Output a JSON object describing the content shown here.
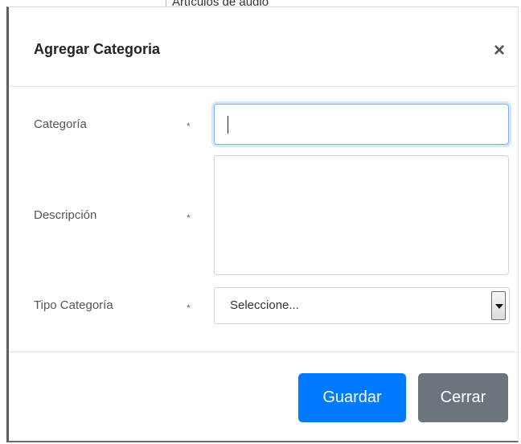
{
  "background": {
    "partial_text": "Artículos de audio"
  },
  "modal": {
    "title": "Agregar Categoria",
    "close_symbol": "×"
  },
  "form": {
    "categoria": {
      "label": "Categoría",
      "required_mark": "*",
      "value": ""
    },
    "descripcion": {
      "label": "Descripción",
      "required_mark": "*",
      "value": ""
    },
    "tipo_categoria": {
      "label": "Tipo Categoría",
      "required_mark": "*",
      "selected": "Seleccione..."
    }
  },
  "footer": {
    "save_label": "Guardar",
    "close_label": "Cerrar"
  },
  "colors": {
    "primary": "#007bff",
    "secondary": "#6c757d",
    "focus_ring": "#80bdff"
  }
}
